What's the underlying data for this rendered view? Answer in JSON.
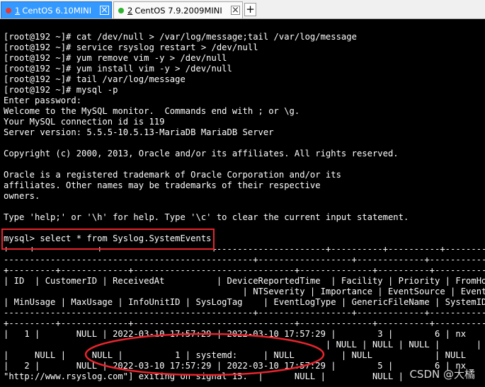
{
  "tabs": [
    {
      "number": "1",
      "title": "CentOS 6.10MINI",
      "active": true,
      "status_color": "#e53935"
    },
    {
      "number": "2",
      "title": "CentOS 7.9.2009MINI",
      "active": false,
      "status_color": "#2fb32f"
    }
  ],
  "new_tab_label": "+",
  "close_label": "×",
  "terminal_lines": [
    "[root@192 ~]# cat /dev/null > /var/log/message;tail /var/log/message",
    "[root@192 ~]# service rsyslog restart > /dev/null",
    "[root@192 ~]# yum remove vim -y > /dev/null",
    "[root@192 ~]# yum install vim -y > /dev/null",
    "[root@192 ~]# tail /var/log/message",
    "[root@192 ~]# mysql -p",
    "Enter password:",
    "Welcome to the MySQL monitor.  Commands end with ; or \\g.",
    "Your MySQL connection id is 119",
    "Server version: 5.5.5-10.5.13-MariaDB MariaDB Server",
    "",
    "Copyright (c) 2000, 2013, Oracle and/or its affiliates. All rights reserved.",
    "",
    "Oracle is a registered trademark of Oracle Corporation and/or its",
    "affiliates. Other names may be trademarks of their respective",
    "owners.",
    "",
    "Type 'help;' or '\\h' for help. Type '\\c' to clear the current input statement.",
    "",
    "mysql> select * from Syslog.SystemEvents;",
    "+----+------------+---------------------+---------------------+----------+----------+----------",
    "------------------------------------------------+------------------+-------------+-------------",
    "+---------+-------------+-------------------------------+--------------+----------+----------",
    "| ID  | CustomerID | ReceivedAt          | DeviceReportedTime  | Facility | Priority | FromHost |",
    "                                              | NTSeverity | Importance | EventSource | EventU",
    "| MinUsage | MaxUsage | InfoUnitID | SysLogTag    | EventLogType | GenericFileName | SystemID |",
    "------------------------------------------------+------------------+-------------+-------------",
    "+---------+-------------+-------------------------------+--------------+----------+----------",
    "|   1 |       NULL | 2022-03-10 17:57:29 | 2022-03-10 17:57:29 |        3 |        6 | nx       |",
    "                                                              | NULL | NULL | NULL |       | NULL",
    "|     NULL |     NULL |          1 | systemd:     | NULL         | NULL            | NULL",
    "|   2 |       NULL | 2022-03-10 17:57:29 | 2022-03-10 17:57:29 |        5 |        6 | nx       |",
    "\"http://www.rsyslog.com\"] exiting on signal 15.  |      NULL |         NULL |"
  ],
  "watermark": "CSDN @大橘"
}
